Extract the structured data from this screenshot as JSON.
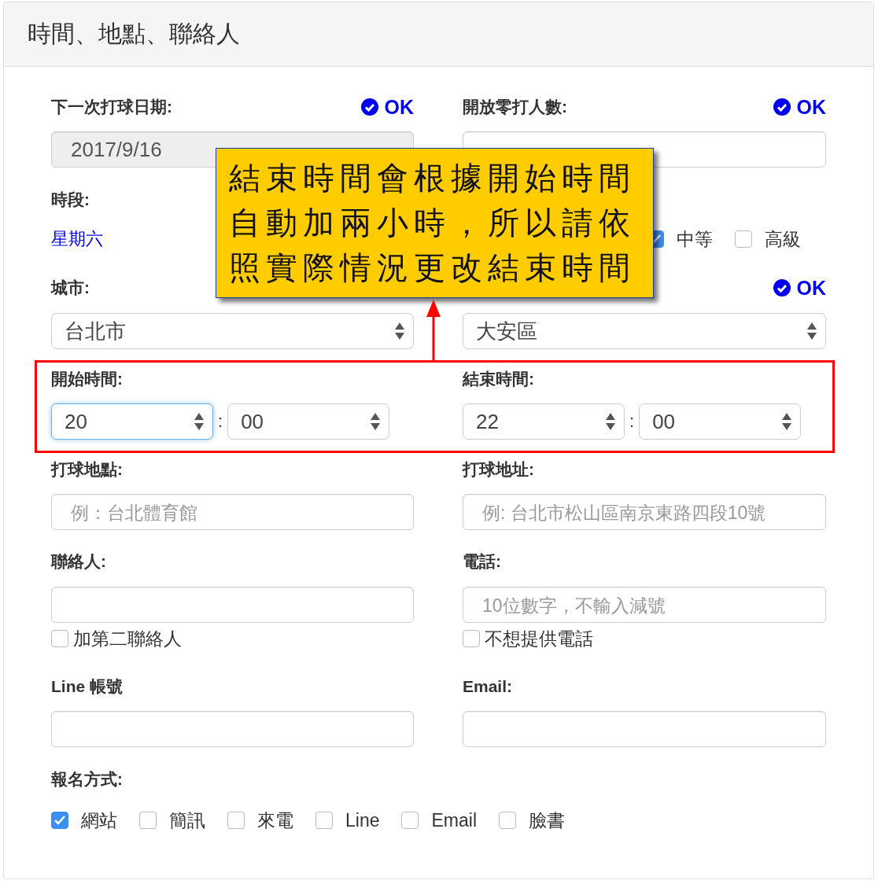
{
  "panel": {
    "title": "時間、地點、聯絡人"
  },
  "next_date": {
    "label": "下一次打球日期:",
    "status": "OK",
    "value": "2017/9/16",
    "disabled": true
  },
  "open_players": {
    "label": "開放零打人數:",
    "status": "OK"
  },
  "time_slot": {
    "label": "時段:",
    "value": "星期六"
  },
  "skill_levels": [
    {
      "label": "中等",
      "checked": true
    },
    {
      "label": "高級",
      "checked": false
    }
  ],
  "city": {
    "label": "城市:",
    "value": "台北市"
  },
  "district": {
    "status": "OK",
    "value": "大安區"
  },
  "start_time": {
    "label": "開始時間:",
    "hour": "20",
    "separator": ":",
    "minute": "00",
    "focused": true
  },
  "end_time": {
    "label": "結束時間:",
    "hour": "22",
    "separator": ":",
    "minute": "00",
    "focused": false
  },
  "venue": {
    "label": "打球地點:",
    "placeholder": "例：台北體育館"
  },
  "address": {
    "label": "打球地址:",
    "placeholder": "例: 台北市松山區南京東路四段10號"
  },
  "contact": {
    "label": "聯絡人:",
    "option": {
      "label": "加第二聯絡人",
      "checked": false
    }
  },
  "phone": {
    "label": "電話:",
    "placeholder": "10位數字，不輸入減號",
    "option": {
      "label": "不想提供電話",
      "checked": false
    }
  },
  "line_account": {
    "label": "Line 帳號"
  },
  "email": {
    "label": "Email:"
  },
  "signup": {
    "label": "報名方式:",
    "methods": [
      {
        "label": "網站",
        "checked": true
      },
      {
        "label": "簡訊",
        "checked": false
      },
      {
        "label": "來電",
        "checked": false
      },
      {
        "label": "Line",
        "checked": false
      },
      {
        "label": "Email",
        "checked": false
      },
      {
        "label": "臉書",
        "checked": false
      }
    ]
  },
  "callout": {
    "lines": [
      "結束時間會根據開始時間",
      "自動加兩小時，所以請依",
      "照實際情況更改結束時間"
    ]
  }
}
